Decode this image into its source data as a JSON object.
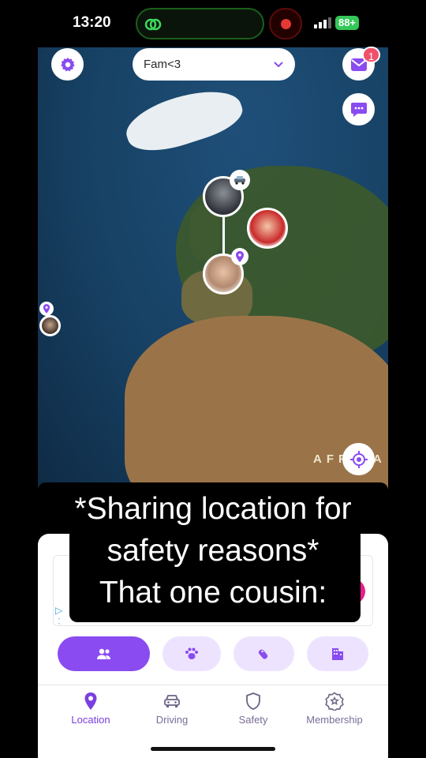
{
  "status_bar": {
    "time": "13:20",
    "battery": "88+"
  },
  "map": {
    "region_label": "AFRICA"
  },
  "header": {
    "circle_name": "Fam<3",
    "mail_badge_count": "1"
  },
  "caption": {
    "line1": "*Sharing location for",
    "line2": "safety reasons*",
    "line3": "That one cousin:"
  },
  "filter_chips": [
    {
      "name": "people",
      "icon": "people-icon"
    },
    {
      "name": "pets",
      "icon": "paw-icon"
    },
    {
      "name": "items",
      "icon": "tile-tag-icon"
    },
    {
      "name": "places",
      "icon": "building-icon"
    }
  ],
  "tabs": [
    {
      "label": "Location",
      "icon": "location-pin-icon",
      "active": true
    },
    {
      "label": "Driving",
      "icon": "car-icon",
      "active": false
    },
    {
      "label": "Safety",
      "icon": "shield-icon",
      "active": false
    },
    {
      "label": "Membership",
      "icon": "star-badge-icon",
      "active": false
    }
  ],
  "colors": {
    "accent": "#8a4bf0",
    "accent_light": "#ede3ff",
    "badge": "#f0506a"
  }
}
